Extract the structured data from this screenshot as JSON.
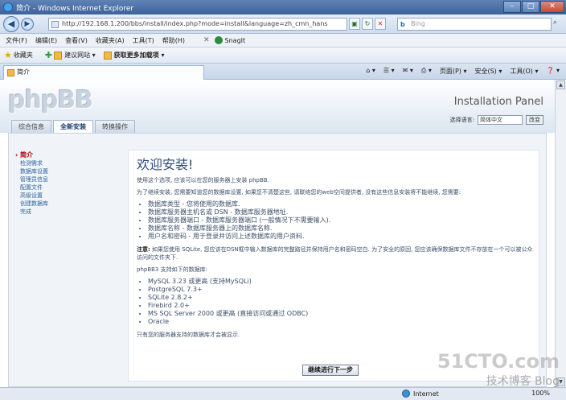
{
  "window": {
    "title": "简介 - Windows Internet Explorer",
    "address": "http://192.168.1.200/bbs/install/index.php?mode=install&language=zh_cmn_hans",
    "search_placeholder": "Bing"
  },
  "menubar": {
    "items": [
      "文件(F)",
      "编辑(E)",
      "查看(V)",
      "收藏夹(A)",
      "工具(T)",
      "帮助(H)"
    ],
    "snagit": "SnagIt"
  },
  "favbar": {
    "favorites": "收藏夹",
    "suggested": "建议网站 ▾",
    "addons": "获取更多加载项 ▾"
  },
  "tab": {
    "label": "简介"
  },
  "cmdbar": {
    "items": [
      "页面(P) ▾",
      "安全(S) ▾",
      "工具(O) ▾"
    ]
  },
  "phpbb": {
    "logo": "phpBB",
    "panel_title": "Installation Panel",
    "lang_label": "选择语言:",
    "lang_value": "简体中文",
    "lang_button": "改变",
    "tabs": [
      "综合信息",
      "全新安装",
      "转换操作"
    ],
    "active_tab": 1,
    "menu": [
      "简介",
      "检测需求",
      "数据库设置",
      "管理员信息",
      "配置文件",
      "高级设置",
      "创建数据库",
      "完成"
    ],
    "heading": "欢迎安装!",
    "intro": "使用这个选项, 应该可以在您的服务器上安装 phpBB.",
    "para2": "为了继续安装, 您需要知道您的数据库设置, 如果您不清楚这些, 请联络您的web空间提供者, 没有这些信息安装将不能继续, 您需要:",
    "requirements": [
      "数据库类型 - 您将使用的数据库.",
      "数据库服务器主机名或 DSN - 数据库服务器地址.",
      "数据库服务器端口 - 数据库服务器端口 (一般情况下不需要输入).",
      "数据库名称 - 数据库服务器上的数据库名称.",
      "用户名和密码 - 用于登录并访问上述数据库的用户资料."
    ],
    "note_label": "注意:",
    "note": "如果您使用 SQLite, 您应该在DSN框中输入数据库的完整路径并保持用户名和密码空白. 为了安全的原因, 您应该确保数据库文件不存放在一个可以被公众访问的文件夹下.",
    "supports": "phpBB3 支持如下的数据库:",
    "databases": [
      "MySQL 3.23 或更高 (支持MySQLi)",
      "PostgreSQL 7.3+",
      "SQLite 2.8.2+",
      "Firebird 2.0+",
      "MS SQL Server 2000 或更高 (直接访问或通过 ODBC)",
      "Oracle"
    ],
    "footer_note": "只有您的服务器支持的数据库才会被显示.",
    "next_button": "继续进行下一步"
  },
  "status": {
    "zone": "Internet",
    "zoom": "100%"
  },
  "watermark": {
    "site": "51CTO.com",
    "sub": "技术博客 Blog"
  }
}
